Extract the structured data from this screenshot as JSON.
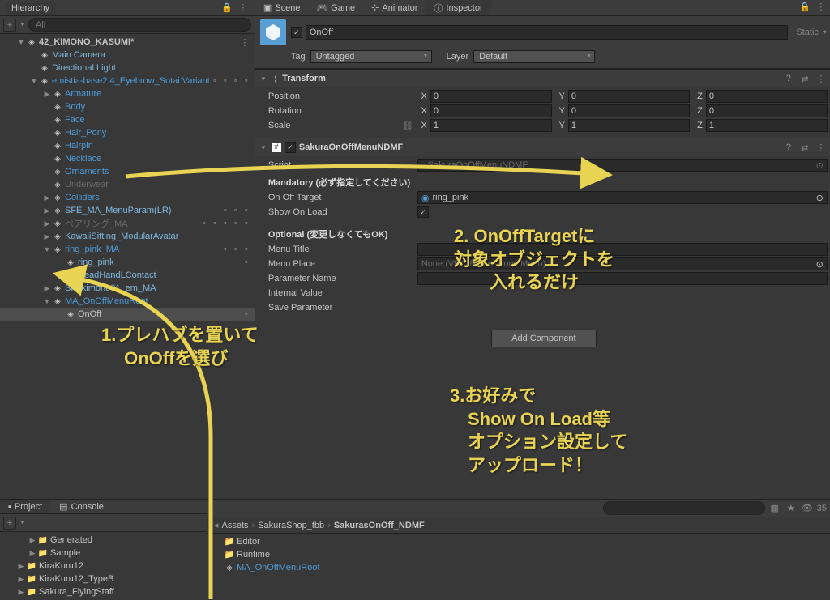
{
  "hierarchy": {
    "title": "Hierarchy",
    "search_placeholder": "All",
    "plus": "+",
    "scene": "42_KIMONO_KASUMI*",
    "items": [
      {
        "label": "Main Camera",
        "indent": 2,
        "style": "blue-light",
        "toggle": ""
      },
      {
        "label": "Directional Light",
        "indent": 2,
        "style": "blue-light",
        "toggle": ""
      },
      {
        "label": "emistia-base2.4_Eyebrow_Sotai Variant",
        "indent": 2,
        "style": "blue-text",
        "toggle": "▼",
        "badges": [
          "hand",
          "#",
          "cube",
          "gear"
        ]
      },
      {
        "label": "Armature",
        "indent": 3,
        "style": "blue-text",
        "toggle": "▶"
      },
      {
        "label": "Body",
        "indent": 3,
        "style": "blue-text",
        "toggle": ""
      },
      {
        "label": "Face",
        "indent": 3,
        "style": "blue-text",
        "toggle": ""
      },
      {
        "label": "Hair_Pony",
        "indent": 3,
        "style": "blue-text",
        "toggle": ""
      },
      {
        "label": "Hairpin",
        "indent": 3,
        "style": "blue-text",
        "toggle": ""
      },
      {
        "label": "Necklace",
        "indent": 3,
        "style": "blue-text",
        "toggle": ""
      },
      {
        "label": "Ornaments",
        "indent": 3,
        "style": "blue-text",
        "toggle": ""
      },
      {
        "label": "Underwear",
        "indent": 3,
        "style": "muted",
        "toggle": ""
      },
      {
        "label": "Colliders",
        "indent": 3,
        "style": "blue-text",
        "toggle": "▶"
      },
      {
        "label": "SFE_MA_MenuParam(LR)",
        "indent": 3,
        "style": "blue-light",
        "toggle": "▶",
        "badges": [
          "b1",
          "b2",
          "b3"
        ]
      },
      {
        "label": "ペアリング_MA",
        "indent": 3,
        "style": "muted",
        "toggle": "▶",
        "badges": [
          "c",
          "c",
          "b1",
          "b2",
          "b3"
        ]
      },
      {
        "label": "KawaiiSitting_ModularAvatar",
        "indent": 3,
        "style": "blue-light",
        "toggle": "▶"
      },
      {
        "label": "ring_pink_MA",
        "indent": 3,
        "style": "blue-text",
        "toggle": "▼",
        "badges": [
          "b1",
          "b2",
          "b3"
        ]
      },
      {
        "label": "ring_pink",
        "indent": 4,
        "style": "blue-light",
        "toggle": "",
        "badges": [
          "grid"
        ]
      },
      {
        "label": "HeadHandLContact",
        "indent": 4,
        "style": "blue-light",
        "toggle": ""
      },
      {
        "label": "SK_kimono01_em_MA",
        "indent": 3,
        "style": "blue-light",
        "toggle": "▶"
      },
      {
        "label": "MA_OnOffMenuRoot",
        "indent": 3,
        "style": "blue-text",
        "toggle": "▼"
      },
      {
        "label": "OnOff",
        "indent": 4,
        "style": "",
        "toggle": "",
        "selected": true,
        "badges": [
          "#"
        ]
      }
    ]
  },
  "inspector": {
    "tabs": {
      "scene": "Scene",
      "game": "Game",
      "animator": "Animator",
      "inspector": "Inspector"
    },
    "go_name": "OnOff",
    "static_label": "Static",
    "tag_label": "Tag",
    "tag_value": "Untagged",
    "layer_label": "Layer",
    "layer_value": "Default",
    "transform": {
      "title": "Transform",
      "position": "Position",
      "rotation": "Rotation",
      "scale": "Scale",
      "x": "X",
      "y": "Y",
      "z": "Z",
      "pos": {
        "x": "0",
        "y": "0",
        "z": "0"
      },
      "rot": {
        "x": "0",
        "y": "0",
        "z": "0"
      },
      "scl": {
        "x": "1",
        "y": "1",
        "z": "1"
      }
    },
    "component": {
      "title": "SakuraOnOffMenuNDMF",
      "script_label": "Script",
      "script_value": "SakuraOnOffMenuNDMF",
      "mandatory_header": "Mandatory (必ず指定してください)",
      "on_off_target": "On Off Target",
      "target_value": "ring_pink",
      "show_on_load": "Show On Load",
      "optional_header": "Optional (変更しなくてもOK)",
      "menu_title": "Menu Title",
      "menu_place": "Menu Place",
      "param_name": "Parameter Name",
      "internal_val": "Internal Value",
      "save_param": "Save Parameter",
      "menu_place_value": "None (VRC Expressions Menu)"
    },
    "add_component": "Add Component"
  },
  "project": {
    "project_tab": "Project",
    "console_tab": "Console",
    "plus": "+",
    "folders": [
      {
        "label": "Generated",
        "indent": 1,
        "toggle": "▶"
      },
      {
        "label": "Sample",
        "indent": 1,
        "toggle": "▶"
      },
      {
        "label": "KiraKuru12",
        "indent": 0,
        "toggle": "▶"
      },
      {
        "label": "KiraKuru12_TypeB",
        "indent": 0,
        "toggle": "▶"
      },
      {
        "label": "Sakura_FlyingStaff",
        "indent": 0,
        "toggle": "▶"
      }
    ],
    "breadcrumb": {
      "root": "Assets",
      "mid": "SakuraShop_tbb",
      "leaf": "SakurasOnOff_NDMF"
    },
    "assets": [
      {
        "label": "Editor",
        "type": "folder"
      },
      {
        "label": "Runtime",
        "type": "folder"
      },
      {
        "label": "MA_OnOffMenuRoot",
        "type": "prefab"
      }
    ],
    "count": "35"
  },
  "annotations": {
    "a1": "1.プレハブを置いて\n　 OnOffを選び",
    "a2": "2. OnOffTargetに\n対象オブジェクトを\n　　入れるだけ",
    "a3": "3.お好みで\n　Show On Load等\n　オプション設定して\n　アップロード！"
  }
}
